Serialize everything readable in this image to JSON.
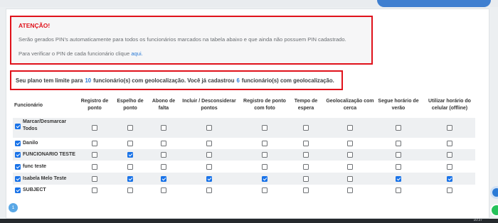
{
  "alert": {
    "title": "ATENÇÃO!",
    "line1": "Serão gerados PIN's automaticamente para todos os funcionários marcados na tabela abaixo e que ainda não possuem PIN cadastrado.",
    "line2_text": "Para verificar o PIN de cada funcionário clique",
    "line2_link": "aqui."
  },
  "limit": {
    "prefix": "Seu plano tem limite para",
    "limit_count": "10",
    "middle": "funcionário(s) com geolocalização.  Você já cadastrou",
    "registered_count": "6",
    "suffix": "funcionário(s) com geolocalização."
  },
  "table": {
    "headers": [
      "Funcionário",
      "Registro de ponto",
      "Espelho de ponto",
      "Abono de falta",
      "Incluir / Desconsiderar pontos",
      "Registro de ponto com foto",
      "Tempo de espera",
      "Geolocalização com cerca",
      "Segue horário de verão",
      "Utilizar horário do celular (offline)"
    ],
    "rows": [
      {
        "name": "Marcar/Desmarcar Todos",
        "name_checked": true,
        "checks": [
          false,
          false,
          false,
          false,
          false,
          false,
          false,
          false,
          false
        ]
      },
      {
        "name": "Danilo",
        "name_checked": true,
        "checks": [
          false,
          false,
          false,
          false,
          false,
          false,
          false,
          false,
          false
        ]
      },
      {
        "name": "FUNCIONARIO TESTE",
        "name_checked": true,
        "checks": [
          false,
          true,
          false,
          false,
          false,
          false,
          false,
          false,
          false
        ]
      },
      {
        "name": "func teste",
        "name_checked": true,
        "checks": [
          false,
          false,
          false,
          false,
          false,
          false,
          false,
          false,
          false
        ]
      },
      {
        "name": "Isabela Melo Teste",
        "name_checked": true,
        "checks": [
          false,
          true,
          true,
          true,
          true,
          false,
          false,
          true,
          true
        ]
      },
      {
        "name": "SUBJECT",
        "name_checked": true,
        "checks": [
          false,
          false,
          false,
          false,
          false,
          false,
          false,
          false,
          false
        ]
      }
    ]
  },
  "pagination": {
    "current_page": "1"
  },
  "taskbar": {
    "clock": "10:37"
  },
  "colors": {
    "alert_red": "#e0121b",
    "accent_blue": "#2b7bd6",
    "checkbox_blue": "#1a73e8"
  },
  "icons": [
    "check-icon",
    "whatsapp-icon",
    "chat-icon"
  ]
}
